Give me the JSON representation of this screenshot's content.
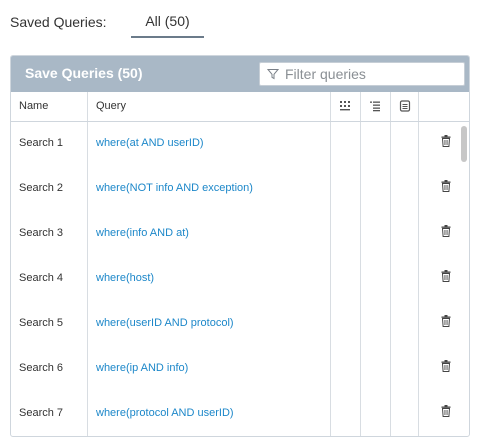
{
  "top": {
    "saved_label": "Saved Queries:",
    "tab_all": "All (50)"
  },
  "panel": {
    "title": "Save Queries (50)",
    "filter_placeholder": "Filter queries"
  },
  "table": {
    "columns": {
      "name": "Name",
      "query": "Query"
    },
    "header_icons": [
      "column-grid-icon",
      "list-icon",
      "document-icon"
    ],
    "rows": [
      {
        "name": "Search 1",
        "query": "where(at AND userID)"
      },
      {
        "name": "Search 2",
        "query": "where(NOT info AND exception)"
      },
      {
        "name": "Search 3",
        "query": "where(info AND at)"
      },
      {
        "name": "Search 4",
        "query": "where(host)"
      },
      {
        "name": "Search 5",
        "query": "where(userID AND protocol)"
      },
      {
        "name": "Search 6",
        "query": "where(ip AND info)"
      },
      {
        "name": "Search 7",
        "query": "where(protocol AND userID)"
      }
    ]
  },
  "colors": {
    "header_bg": "#a9b8c6",
    "link": "#1c87c9",
    "border": "#cfd6dd"
  }
}
